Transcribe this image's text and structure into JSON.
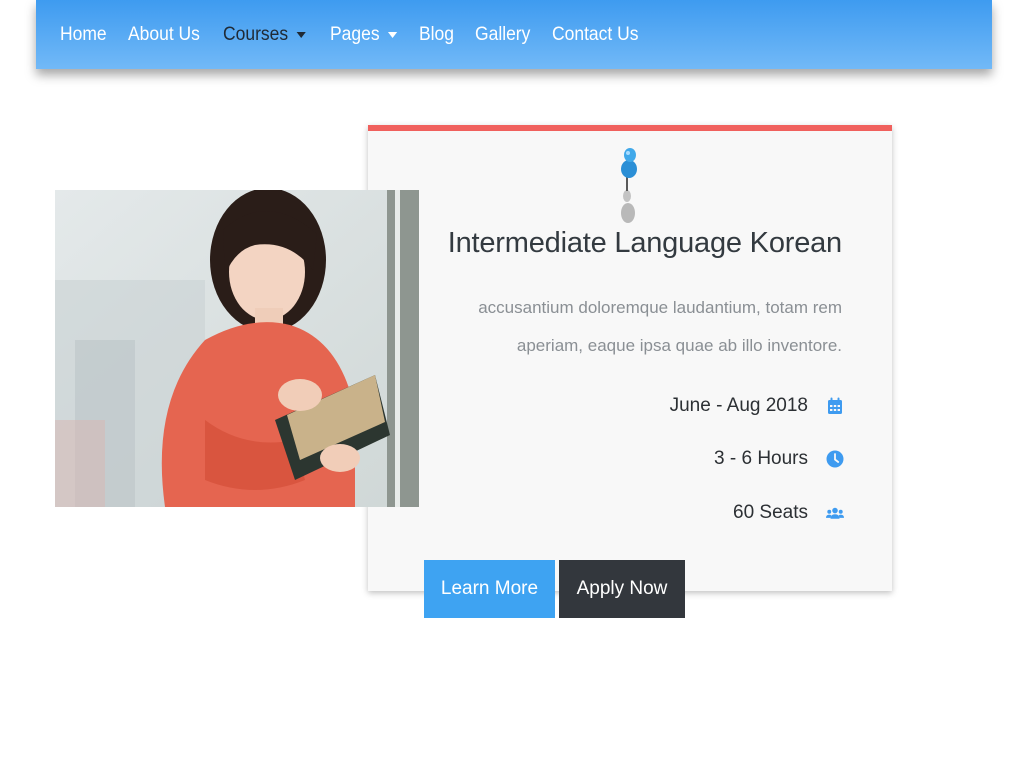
{
  "navbar": {
    "items": [
      {
        "label": "Home",
        "dropdown": false
      },
      {
        "label": "About Us",
        "dropdown": false
      },
      {
        "label": "Courses",
        "dropdown": true
      },
      {
        "label": "Pages",
        "dropdown": true
      },
      {
        "label": "Blog",
        "dropdown": false
      },
      {
        "label": "Gallery",
        "dropdown": false
      },
      {
        "label": "Contact Us",
        "dropdown": false
      }
    ]
  },
  "course": {
    "title": "Intermediate Language Korean",
    "description": "accusantium doloremque laudantium, totam rem aperiam, eaque ipsa quae ab illo inventore.",
    "date": "June - Aug 2018",
    "date_icon": "calendar-icon",
    "hours": "3 - 6 Hours",
    "hours_icon": "clock-icon",
    "seats": "60 Seats",
    "seats_icon": "users-icon",
    "pin_icon": "pushpin-icon"
  },
  "buttons": {
    "learn_more": "Learn More",
    "apply_now": "Apply Now"
  },
  "colors": {
    "navbar": "#3e9bf0",
    "card_accent": "#f0605d",
    "icon_blue": "#3e9bf0",
    "learn_button": "#3ea3f2",
    "apply_button": "#33373d"
  }
}
